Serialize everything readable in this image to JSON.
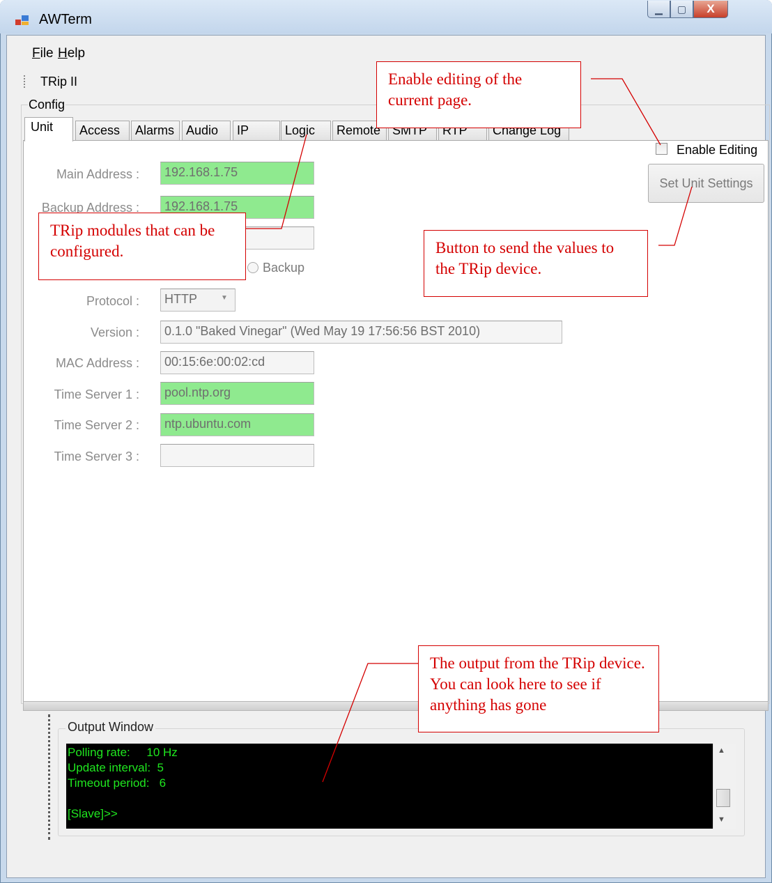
{
  "window": {
    "title": "AWTerm",
    "controls": {
      "minimize": "▁",
      "maximize": "▢",
      "close": "X"
    }
  },
  "menu": [
    {
      "label": "File",
      "accel": "F"
    },
    {
      "label": "Help",
      "accel": "H"
    }
  ],
  "toolbar": {
    "label": "TRip II"
  },
  "config": {
    "group_label": "Config",
    "tabs": [
      "Unit",
      "Access",
      "Alarms",
      "Audio",
      "IP",
      "Logic",
      "Remote",
      "SMTP",
      "RTP",
      "Change Log"
    ],
    "active_tab": "Unit"
  },
  "unit": {
    "main_address_label": "Main Address :",
    "main_address": "192.168.1.75",
    "backup_address_label": "Backup Address :",
    "backup_address": "192.168.1.75",
    "backup_radio_label": "Backup",
    "protocol_label": "Protocol :",
    "protocol": "HTTP",
    "version_label": "Version :",
    "version": "0.1.0 \"Baked Vinegar\" (Wed May 19 17:56:56 BST 2010)",
    "mac_label": "MAC Address :",
    "mac": "00:15:6e:00:02:cd",
    "ts1_label": "Time Server 1 :",
    "ts1": "pool.ntp.org",
    "ts2_label": "Time Server 2 :",
    "ts2": "ntp.ubuntu.com",
    "ts3_label": "Time Server 3 :",
    "ts3": "",
    "enable_editing_label": "Enable Editing",
    "enable_editing_checked": false,
    "set_button_label": "Set Unit Settings"
  },
  "output": {
    "label": "Output Window",
    "lines": [
      "Polling rate:     10 Hz",
      "Update interval:  5",
      "Timeout period:   6",
      "",
      "[Slave]>>"
    ]
  },
  "annotations": {
    "enable_editing": "Enable editing of the current page.",
    "trip_modules": "TRip modules that can be configured.",
    "send_button": "Button to send the values to the TRip device.",
    "output": "The output from the TRip device.   You can look here to see if anything has gone"
  },
  "colors": {
    "highlight_field": "#8fea8f",
    "console_bg": "#000000",
    "console_text": "#1fe61f",
    "annotation": "#d40000"
  }
}
